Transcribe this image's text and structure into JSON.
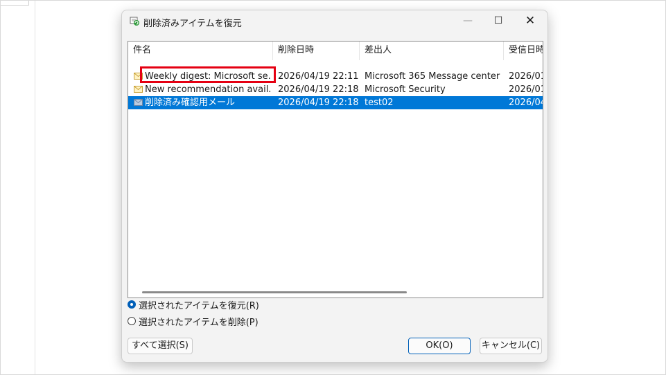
{
  "dialog": {
    "title": "削除済みアイテムを復元",
    "window_controls": {
      "minimize": "—",
      "maximize": "☐",
      "close": "✕"
    }
  },
  "list": {
    "columns": [
      "件名",
      "削除日時",
      "差出人",
      "受信日時"
    ],
    "rows": [
      {
        "icon": "envelope-icon",
        "subject": "Weekly digest: Microsoft se...",
        "deleted": "2026/04/19 22:11",
        "sender": "Microsoft 365 Message center",
        "received": "2026/01",
        "selected": false
      },
      {
        "icon": "envelope-icon",
        "subject": "New recommendation avail...",
        "deleted": "2026/04/19 22:18",
        "sender": "Microsoft Security",
        "received": "2026/01",
        "selected": false
      },
      {
        "icon": "envelope-icon",
        "subject": "削除済み確認用メール",
        "deleted": "2026/04/19 22:18",
        "sender": "test02",
        "received": "2026/04",
        "selected": true
      }
    ],
    "selection_color": "#0078d7",
    "highlight_color": "#e50012"
  },
  "options": {
    "restore_label": "選択されたアイテムを復元(R)",
    "delete_label": "選択されたアイテムを削除(P)",
    "selected": "restore"
  },
  "buttons": {
    "select_all": "すべて選択(S)",
    "ok": "OK(O)",
    "cancel": "キャンセル(C)"
  }
}
